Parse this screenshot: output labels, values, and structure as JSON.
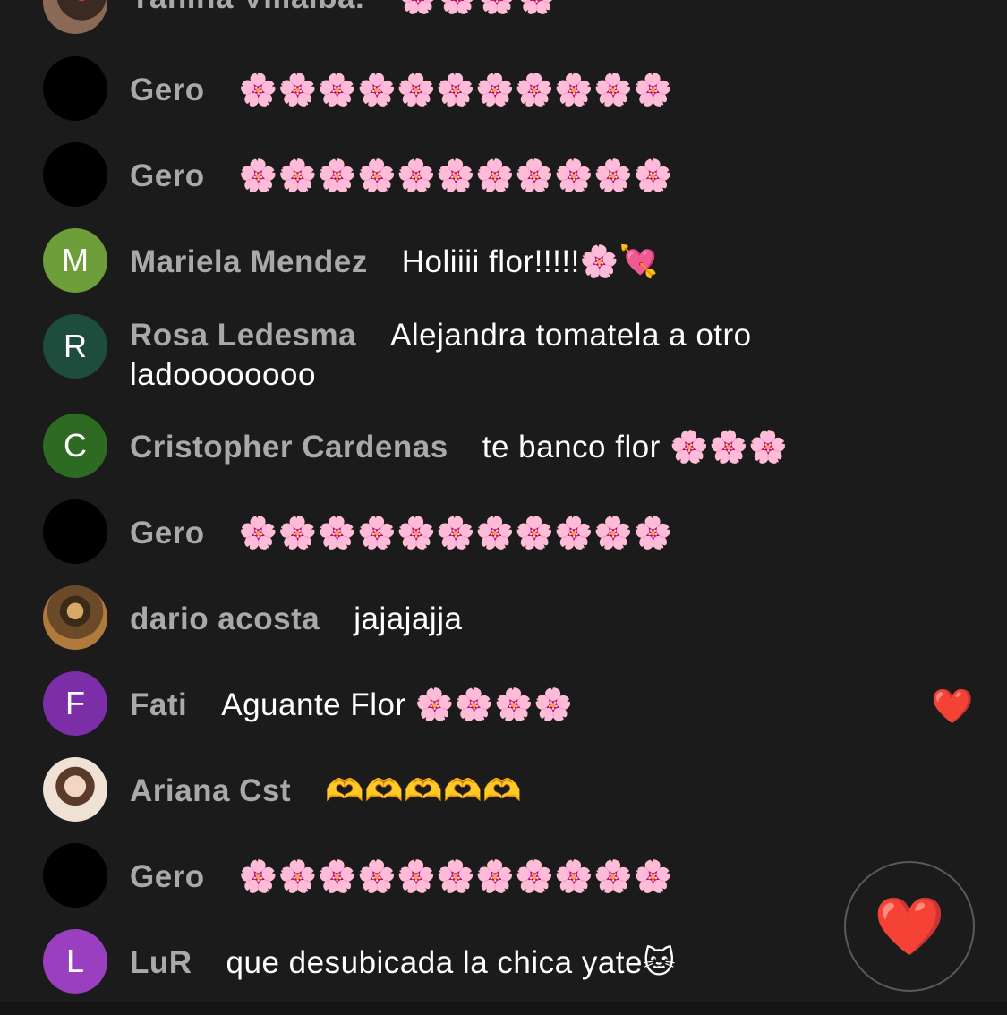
{
  "comments": [
    {
      "avatar": "",
      "avatar_type": "photo",
      "name": "Yanina Villalba.",
      "message": "🌸🌸🌸🌸"
    },
    {
      "avatar": "",
      "avatar_type": "black",
      "name": "Gero",
      "message": "🌸🌸🌸🌸🌸🌸🌸🌸🌸🌸🌸"
    },
    {
      "avatar": "",
      "avatar_type": "black",
      "name": "Gero",
      "message": "🌸🌸🌸🌸🌸🌸🌸🌸🌸🌸🌸"
    },
    {
      "avatar": "M",
      "avatar_color": "#6e9e3a",
      "name": "Mariela Mendez",
      "message": "Holiiii flor!!!!!🌸💘"
    },
    {
      "avatar": "R",
      "avatar_color": "#1f4d3d",
      "name": "Rosa Ledesma",
      "message": "Alejandra tomatela a otro ladoooooooo"
    },
    {
      "avatar": "C",
      "avatar_color": "#2e6b22",
      "name": "Cristopher Cardenas",
      "message": "te banco flor 🌸🌸🌸"
    },
    {
      "avatar": "",
      "avatar_type": "black",
      "name": "Gero",
      "message": "🌸🌸🌸🌸🌸🌸🌸🌸🌸🌸🌸"
    },
    {
      "avatar": "",
      "avatar_type": "photo",
      "name": "dario acosta",
      "message": "jajajajja"
    },
    {
      "avatar": "F",
      "avatar_color": "#7b2ea8",
      "name": "Fati",
      "message": "Aguante Flor 🌸🌸🌸🌸",
      "liked": "❤️"
    },
    {
      "avatar": "",
      "avatar_type": "photo",
      "name": "Ariana Cst",
      "message": "🫶🫶🫶🫶🫶"
    },
    {
      "avatar": "",
      "avatar_type": "black",
      "name": "Gero",
      "message": "🌸🌸🌸🌸🌸🌸🌸🌸🌸🌸🌸"
    },
    {
      "avatar": "L",
      "avatar_color": "#9b3fc1",
      "name": "LuR",
      "message": "que desubicada la chica yate🐱"
    }
  ],
  "like_button": {
    "icon": "❤️",
    "icon_name": "heart-icon"
  }
}
